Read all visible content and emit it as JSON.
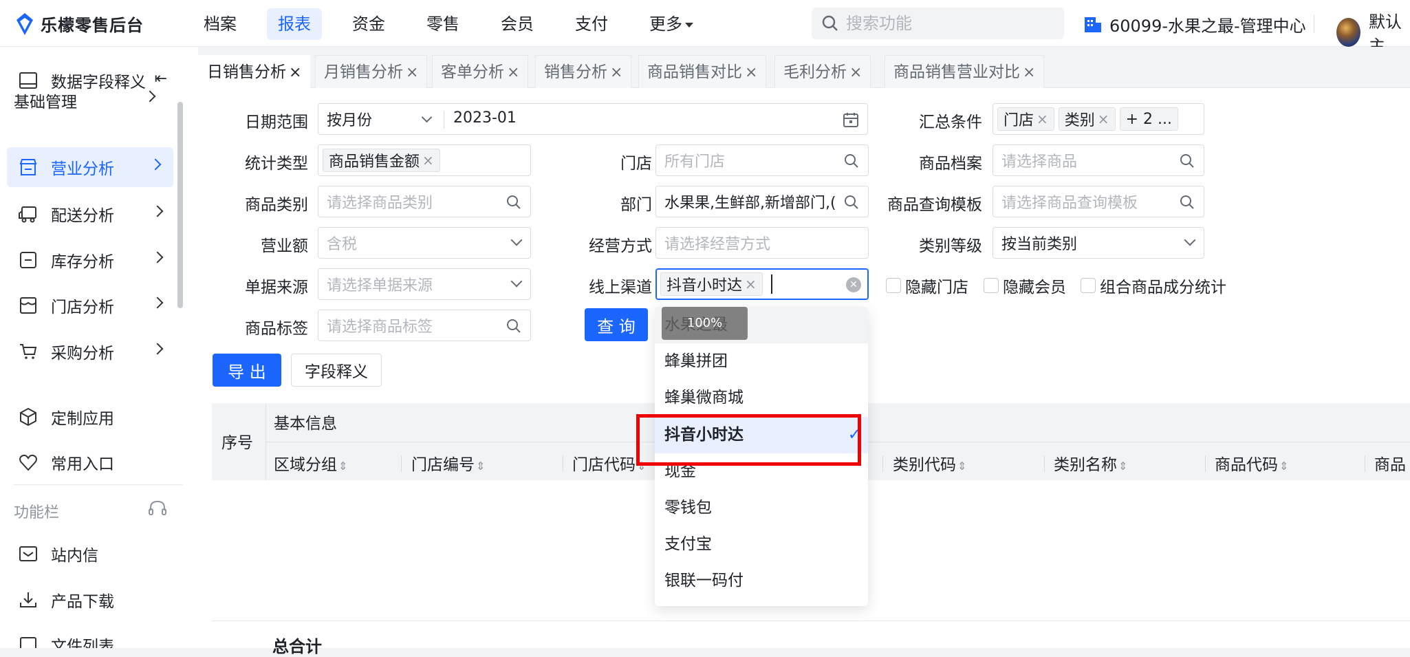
{
  "header": {
    "logo_text": "乐檬零售后台",
    "nav": [
      {
        "label": "档案",
        "active": false
      },
      {
        "label": "报表",
        "active": true
      },
      {
        "label": "资金",
        "active": false
      },
      {
        "label": "零售",
        "active": false
      },
      {
        "label": "会员",
        "active": false
      },
      {
        "label": "支付",
        "active": false
      },
      {
        "label": "更多",
        "active": false,
        "has_caret": true
      }
    ],
    "search_placeholder": "搜索功能",
    "org_name": "60099-水果之最-管理中心",
    "user_name": "默认主"
  },
  "sidebar": {
    "top_item": "数据字段释义",
    "section_basic": "基础管理",
    "items": [
      {
        "label": "营业分析",
        "icon": "shop-icon",
        "active": true
      },
      {
        "label": "配送分析",
        "icon": "delivery-truck-icon"
      },
      {
        "label": "库存分析",
        "icon": "inventory-box-icon"
      },
      {
        "label": "门店分析",
        "icon": "store-icon"
      },
      {
        "label": "采购分析",
        "icon": "shopping-cart-icon"
      }
    ],
    "custom_app": "定制应用",
    "common_entry": "常用入口",
    "function_bar": "功能栏",
    "station_mail": "站内信",
    "product_download": "产品下载",
    "file_list": "文件列表"
  },
  "tabs": [
    {
      "label": "日销售分析",
      "active": true
    },
    {
      "label": "月销售分析"
    },
    {
      "label": "客单分析"
    },
    {
      "label": "销售分析"
    },
    {
      "label": "商品销售对比"
    },
    {
      "label": "毛利分析"
    },
    {
      "label": "商品销售营业对比"
    }
  ],
  "filters": {
    "date_range": {
      "label": "日期范围",
      "mode": "按月份",
      "value": "2023-01"
    },
    "summary": {
      "label": "汇总条件",
      "tags": [
        "门店",
        "类别"
      ],
      "more": "+ 2 ..."
    },
    "stat_type": {
      "label": "统计类型",
      "tag": "商品销售金额"
    },
    "store": {
      "label": "门店",
      "placeholder": "所有门店"
    },
    "product_file": {
      "label": "商品档案",
      "placeholder": "请选择商品"
    },
    "category": {
      "label": "商品类别",
      "placeholder": "请选择商品类别"
    },
    "department": {
      "label": "部门",
      "value": "水果果,生鲜部,新增部门,("
    },
    "query_template": {
      "label": "商品查询模板",
      "placeholder": "请选择商品查询模板"
    },
    "revenue": {
      "label": "营业额",
      "value": "含税"
    },
    "business_mode": {
      "label": "经营方式",
      "placeholder": "请选择经营方式"
    },
    "category_level": {
      "label": "类别等级",
      "value": "按当前类别"
    },
    "bill_source": {
      "label": "单据来源",
      "placeholder": "请选择单据来源"
    },
    "online_channel": {
      "label": "线上渠道",
      "tag": "抖音小时达"
    },
    "product_tag": {
      "label": "商品标签",
      "placeholder": "请选择商品标签"
    },
    "checkboxes": [
      "隐藏门店",
      "隐藏会员",
      "组合商品成分统计"
    ]
  },
  "buttons": {
    "query": "查 询",
    "export": "导 出",
    "field_def": "字段释义"
  },
  "table": {
    "seq": "序号",
    "group": "基本信息",
    "columns": [
      "区域分组",
      "门店编号",
      "门店代码",
      "类别代码",
      "类别名称",
      "商品代码",
      "商品"
    ],
    "total": "总合计"
  },
  "dropdown": {
    "options": [
      "水果之最",
      "蜂巢拼团",
      "蜂巢微商城",
      "抖音小时达",
      "现金",
      "零钱包",
      "支付宝",
      "银联一码付"
    ],
    "selected_index": 3,
    "tooltip": "100%"
  },
  "colors": {
    "accent": "#1a66ff",
    "highlight_box": "#f00000"
  }
}
